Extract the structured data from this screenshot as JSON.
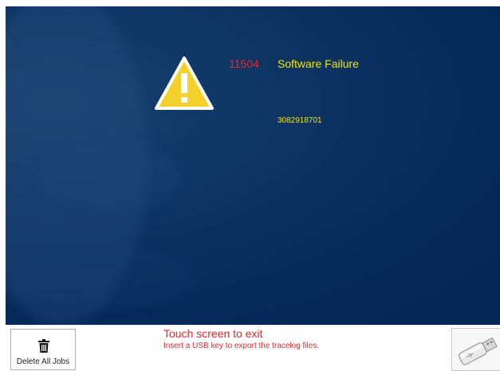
{
  "error": {
    "code": "11504",
    "title": "Software Failure",
    "detail": "3082918701"
  },
  "footer": {
    "delete_all_label": "Delete All Jobs",
    "exit_text": "Touch screen to exit",
    "usb_hint": "Insert a USB key to export the tracelog files."
  },
  "icons": {
    "warning": "warning-triangle-icon",
    "delete": "trash-icon",
    "usb": "usb-key-icon"
  },
  "colors": {
    "panel_background": "#062a5a",
    "error_code": "#e8262b",
    "error_text": "#f2e500",
    "warning_fill": "#f4d02a",
    "footer_text": "#e8262b"
  }
}
